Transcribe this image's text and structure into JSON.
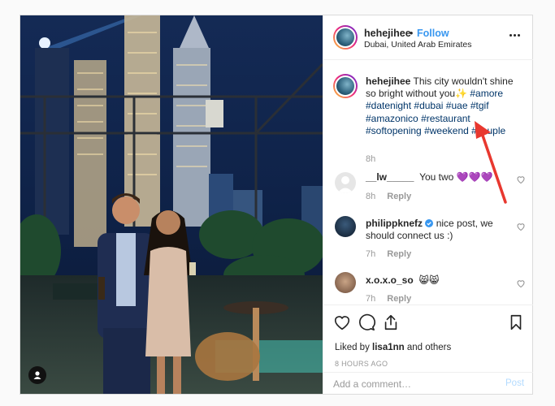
{
  "post": {
    "username": "hehejihee",
    "separator": "•",
    "follow_label": "Follow",
    "location": "Dubai, United Arab Emirates"
  },
  "caption": {
    "username": "hehejihee",
    "text": "This city wouldn't shine so bright without you",
    "sparkle": "✨",
    "hashtags": [
      "#amore",
      "#datenight",
      "#dubai",
      "#uae",
      "#tgif",
      "#amazonico",
      "#restaurant",
      "#softopening",
      "#weekend",
      "#couple"
    ],
    "time": "8h"
  },
  "comments": [
    {
      "username": "__lw_____",
      "text": "You two 💜💜💜",
      "time": "8h",
      "reply_label": "Reply"
    },
    {
      "username": "philippknefz",
      "verified": true,
      "text": "nice post, we should connect us :)",
      "time": "7h",
      "reply_label": "Reply"
    },
    {
      "username": "x.o.x.o_so",
      "text": "😸😸",
      "time": "7h",
      "reply_label": "Reply"
    }
  ],
  "actions": {
    "likes_prefix": "Liked by",
    "likes_user": "lisa1nn",
    "likes_suffix": "and others",
    "time_ago": "8 HOURS AGO",
    "comment_placeholder": "Add a comment…",
    "post_label": "Post"
  },
  "colors": {
    "link_blue": "#3897f0",
    "hashtag": "#003569",
    "muted": "#999999",
    "annotation_arrow": "#e8382f"
  },
  "icons": [
    "more-options-icon",
    "heart-icon",
    "comment-icon",
    "share-icon",
    "bookmark-icon",
    "user-tag-icon",
    "verified-badge-icon",
    "red-arrow-annotation"
  ]
}
